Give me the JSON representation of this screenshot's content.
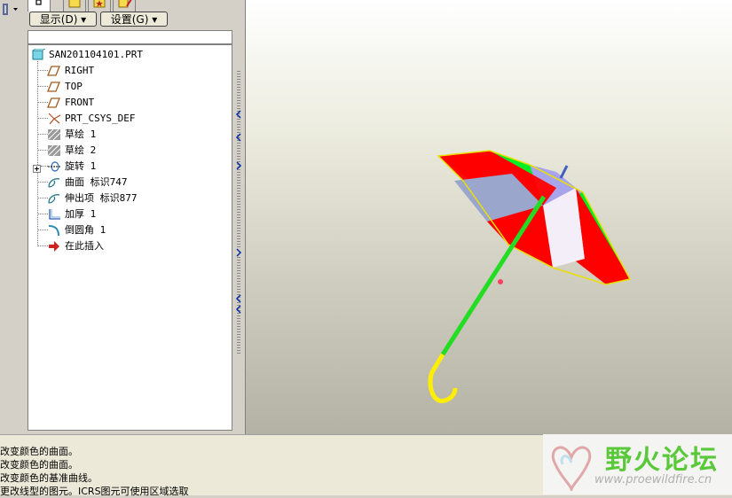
{
  "menu": {
    "show_label": "显示(D) ▾",
    "settings_label": "设置(G) ▾"
  },
  "tree": {
    "items": [
      {
        "label": "SAN201104101.PRT",
        "icon": "part-icon"
      },
      {
        "label": "RIGHT",
        "icon": "datum-plane-icon"
      },
      {
        "label": "TOP",
        "icon": "datum-plane-icon"
      },
      {
        "label": "FRONT",
        "icon": "datum-plane-icon"
      },
      {
        "label": "PRT_CSYS_DEF",
        "icon": "coordinate-system-icon"
      },
      {
        "label": "草绘 1",
        "icon": "sketch-icon"
      },
      {
        "label": "草绘 2",
        "icon": "sketch-icon"
      },
      {
        "label": "旋转 1",
        "icon": "revolve-icon",
        "expandable": true
      },
      {
        "label": "曲面 标识747",
        "icon": "surface-icon"
      },
      {
        "label": "伸出项 标识877",
        "icon": "protrusion-icon"
      },
      {
        "label": "加厚 1",
        "icon": "thicken-icon"
      },
      {
        "label": "倒圆角 1",
        "icon": "round-icon"
      },
      {
        "label": "在此插入",
        "icon": "insert-here-icon"
      }
    ]
  },
  "messages": [
    "改变颜色的曲面。",
    "改变颜色的曲面。",
    "改变颜色的基准曲线。",
    "更改线型的图元。ICRS图元可使用区域选取"
  ],
  "watermark": {
    "title": "野火论坛",
    "url": "www.proewildfire.cn"
  },
  "colors": {
    "canopy_red": "#ff0000",
    "canopy_green": "#00ee22",
    "canopy_white": "#f4eef8",
    "canopy_lavender": "#a8a4ec",
    "shaft_green": "#22dd22",
    "handle_yellow": "#ffee00",
    "trim_yellow": "#e8e000",
    "watermark_green": "#59c93a"
  }
}
